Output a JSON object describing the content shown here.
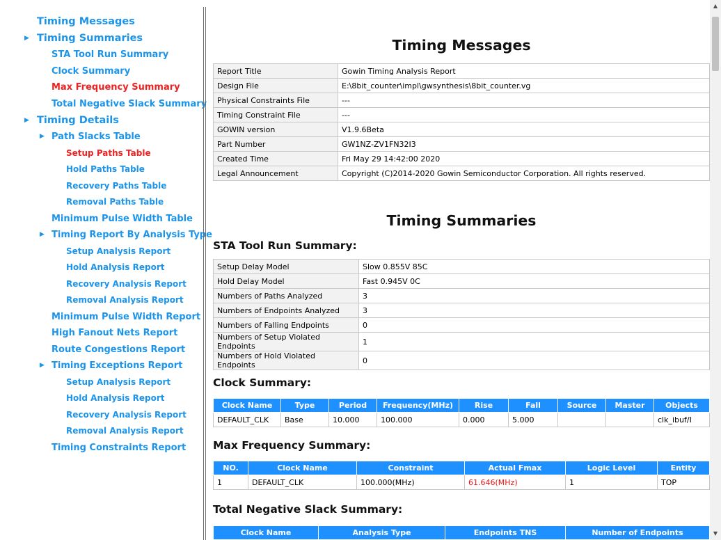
{
  "sidebar": [
    {
      "label": "Timing Messages",
      "level": 0,
      "caret": false
    },
    {
      "label": "Timing Summaries",
      "level": 0,
      "caret": true
    },
    {
      "label": "STA Tool Run Summary",
      "level": 1,
      "caret": false
    },
    {
      "label": "Clock Summary",
      "level": 1,
      "caret": false
    },
    {
      "label": "Max Frequency Summary",
      "level": 1,
      "caret": false,
      "active": true
    },
    {
      "label": "Total Negative Slack Summary",
      "level": 1,
      "caret": false
    },
    {
      "label": "Timing Details",
      "level": 0,
      "caret": true
    },
    {
      "label": "Path Slacks Table",
      "level": 1,
      "caret": true
    },
    {
      "label": "Setup Paths Table",
      "level": 2,
      "caret": false,
      "active": true
    },
    {
      "label": "Hold Paths Table",
      "level": 2,
      "caret": false
    },
    {
      "label": "Recovery Paths Table",
      "level": 2,
      "caret": false
    },
    {
      "label": "Removal Paths Table",
      "level": 2,
      "caret": false
    },
    {
      "label": "Minimum Pulse Width Table",
      "level": 1,
      "caret": false
    },
    {
      "label": "Timing Report By Analysis Type",
      "level": 1,
      "caret": true
    },
    {
      "label": "Setup Analysis Report",
      "level": 2,
      "caret": false
    },
    {
      "label": "Hold Analysis Report",
      "level": 2,
      "caret": false
    },
    {
      "label": "Recovery Analysis Report",
      "level": 2,
      "caret": false
    },
    {
      "label": "Removal Analysis Report",
      "level": 2,
      "caret": false
    },
    {
      "label": "Minimum Pulse Width Report",
      "level": 1,
      "caret": false
    },
    {
      "label": "High Fanout Nets Report",
      "level": 1,
      "caret": false
    },
    {
      "label": "Route Congestions Report",
      "level": 1,
      "caret": false
    },
    {
      "label": "Timing Exceptions Report",
      "level": 1,
      "caret": true
    },
    {
      "label": "Setup Analysis Report",
      "level": 2,
      "caret": false
    },
    {
      "label": "Hold Analysis Report",
      "level": 2,
      "caret": false
    },
    {
      "label": "Recovery Analysis Report",
      "level": 2,
      "caret": false
    },
    {
      "label": "Removal Analysis Report",
      "level": 2,
      "caret": false
    },
    {
      "label": "Timing Constraints Report",
      "level": 1,
      "caret": false
    }
  ],
  "caret_glyph": "▶",
  "headings": {
    "timing_messages": "Timing Messages",
    "timing_summaries": "Timing Summaries",
    "sta_tool_run_summary": "STA Tool Run Summary:",
    "clock_summary": "Clock Summary:",
    "max_frequency_summary": "Max Frequency Summary:",
    "total_negative_slack_summary": "Total Negative Slack Summary:"
  },
  "messages": [
    [
      "Report Title",
      "Gowin Timing Analysis Report"
    ],
    [
      "Design File",
      "E:\\8bit_counter\\impl\\gwsynthesis\\8bit_counter.vg"
    ],
    [
      "Physical Constraints File",
      "---"
    ],
    [
      "Timing Constraint File",
      "---"
    ],
    [
      "GOWIN version",
      "V1.9.6Beta"
    ],
    [
      "Part Number",
      "GW1NZ-ZV1FN32I3"
    ],
    [
      "Created Time",
      "Fri May 29 14:42:00 2020"
    ],
    [
      "Legal Announcement",
      "Copyright (C)2014-2020 Gowin Semiconductor Corporation. All rights reserved."
    ]
  ],
  "sta_summary": [
    [
      "Setup Delay Model",
      "Slow 0.855V 85C"
    ],
    [
      "Hold Delay Model",
      "Fast 0.945V 0C"
    ],
    [
      "Numbers of Paths Analyzed",
      "3"
    ],
    [
      "Numbers of Endpoints Analyzed",
      "3"
    ],
    [
      "Numbers of Falling Endpoints",
      "0"
    ],
    [
      "Numbers of Setup Violated Endpoints",
      "1"
    ],
    [
      "Numbers of Hold Violated Endpoints",
      "0"
    ]
  ],
  "clock_summary": {
    "headers": [
      "Clock Name",
      "Type",
      "Period",
      "Frequency(MHz)",
      "Rise",
      "Fall",
      "Source",
      "Master",
      "Objects"
    ],
    "rows": [
      [
        "DEFAULT_CLK",
        "Base",
        "10.000",
        "100.000",
        "0.000",
        "5.000",
        "",
        "",
        "clk_ibuf/I"
      ]
    ]
  },
  "max_freq": {
    "headers": [
      "NO.",
      "Clock Name",
      "Constraint",
      "Actual Fmax",
      "Logic Level",
      "Entity"
    ],
    "rows": [
      [
        "1",
        "DEFAULT_CLK",
        "100.000(MHz)",
        "61.646(MHz)",
        "1",
        "TOP"
      ]
    ]
  },
  "tns": {
    "headers": [
      "Clock Name",
      "Analysis Type",
      "Endpoints TNS",
      "Number of Endpoints"
    ]
  },
  "colors": {
    "link": "#1c94ea",
    "active": "#ee2222",
    "header_bg": "#1e90ff",
    "fmax_red": "#e81515"
  },
  "scroll_icons": {
    "up": "▲",
    "down": "▼"
  }
}
